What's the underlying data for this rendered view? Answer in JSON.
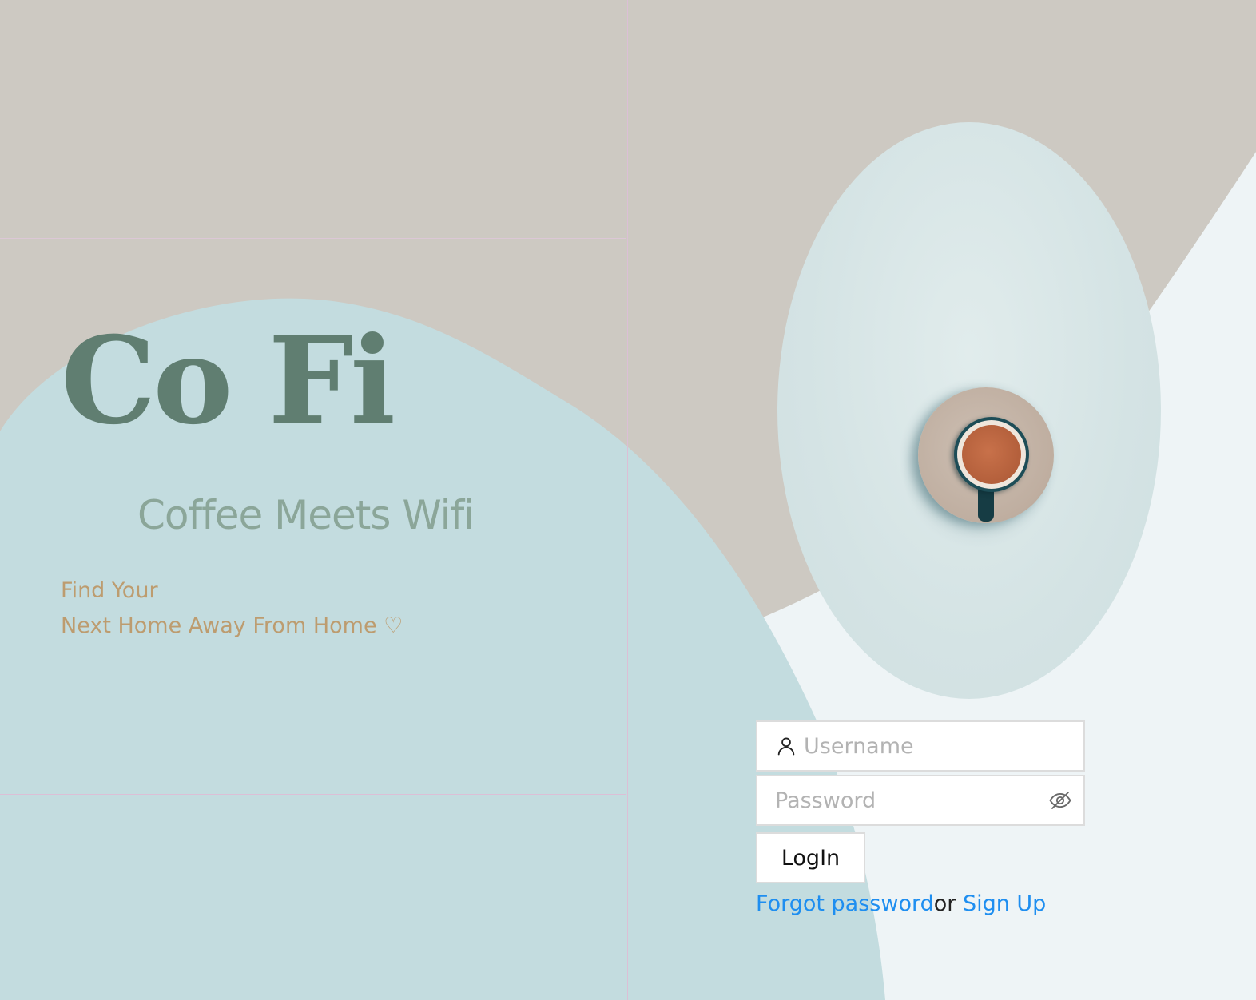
{
  "brand": {
    "title": "Co Fi",
    "tagline": "Coffee Meets Wifi",
    "subtext_line1": "Find Your",
    "subtext_line2": "Next Home Away From Home ♡"
  },
  "login": {
    "username_placeholder": "Username",
    "password_placeholder": "Password",
    "login_label": "LogIn",
    "forgot_password_label": "Forgot password",
    "or_text": "or ",
    "sign_up_label": "Sign Up"
  },
  "icons": {
    "username": "user-icon",
    "password_toggle": "eye-slash-icon",
    "hero": "coffee-cup-photo"
  },
  "colors": {
    "background_beige": "#cdc9c2",
    "blob_blue": "#c3dcdf",
    "panel_light": "#eef4f6",
    "brand_green": "#607e71",
    "tagline_green": "#8ba699",
    "subtext_gold": "#bd9c6f",
    "link_blue": "#1e8ef0"
  }
}
